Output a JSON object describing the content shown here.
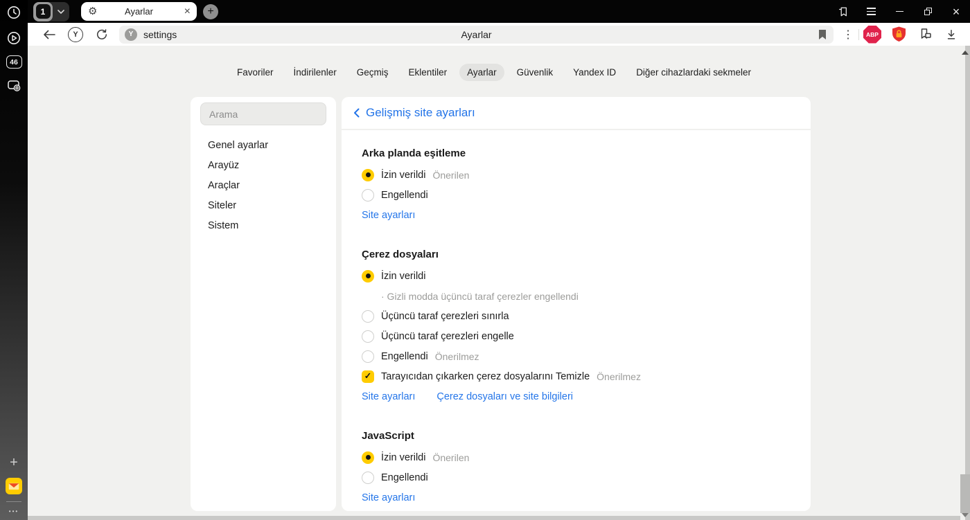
{
  "colors": {
    "accent_yellow": "#ffcc00",
    "link_blue": "#2576e9",
    "abp_red": "#e0234c",
    "protect_red": "#e23333",
    "page_bg": "#f1f1ef",
    "chrome_black": "#050505"
  },
  "icons": {
    "gear": "⚙",
    "plus": "+",
    "close": "×",
    "menu_dots": "⋮",
    "more_dots": "•••",
    "check": "✓",
    "yandex_letter": "Y"
  },
  "browser": {
    "tab_bar": {
      "tab_count": "1",
      "tab_title": "Ayarlar"
    },
    "toolbar": {
      "url_text": "settings",
      "page_title": "Ayarlar",
      "abp_label": "ABP"
    }
  },
  "left_rail": {
    "badge_count": "46"
  },
  "nav_tabs": {
    "items": [
      {
        "label": "Favoriler",
        "active": false
      },
      {
        "label": "İndirilenler",
        "active": false
      },
      {
        "label": "Geçmiş",
        "active": false
      },
      {
        "label": "Eklentiler",
        "active": false
      },
      {
        "label": "Ayarlar",
        "active": true
      },
      {
        "label": "Güvenlik",
        "active": false
      },
      {
        "label": "Yandex ID",
        "active": false
      },
      {
        "label": "Diğer cihazlardaki sekmeler",
        "active": false
      }
    ]
  },
  "settings_menu": {
    "search_placeholder": "Arama",
    "items": [
      "Genel ayarlar",
      "Arayüz",
      "Araçlar",
      "Siteler",
      "Sistem"
    ]
  },
  "content": {
    "header": "Gelişmiş site ayarları",
    "sections": [
      {
        "title": "Arka planda eşitleme",
        "options": [
          {
            "type": "radio",
            "checked": true,
            "label": "İzin verildi",
            "badge": "Önerilen"
          },
          {
            "type": "radio",
            "checked": false,
            "label": "Engellendi"
          }
        ],
        "links": [
          "Site ayarları"
        ]
      },
      {
        "title": "Çerez dosyaları",
        "options": [
          {
            "type": "radio",
            "checked": true,
            "label": "İzin verildi"
          },
          {
            "type": "note",
            "label": "· Gizli modda üçüncü taraf çerezler engellendi"
          },
          {
            "type": "radio",
            "checked": false,
            "label": "Üçüncü taraf çerezleri sınırla"
          },
          {
            "type": "radio",
            "checked": false,
            "label": "Üçüncü taraf çerezleri engelle"
          },
          {
            "type": "radio",
            "checked": false,
            "label": "Engellendi",
            "badge": "Önerilmez"
          },
          {
            "type": "checkbox",
            "checked": true,
            "label": "Tarayıcıdan çıkarken çerez dosyalarını Temizle",
            "badge": "Önerilmez"
          }
        ],
        "links": [
          "Site ayarları",
          "Çerez dosyaları ve site bilgileri"
        ]
      },
      {
        "title": "JavaScript",
        "options": [
          {
            "type": "radio",
            "checked": true,
            "label": "İzin verildi",
            "badge": "Önerilen"
          },
          {
            "type": "radio",
            "checked": false,
            "label": "Engellendi"
          }
        ],
        "links": [
          "Site ayarları"
        ]
      }
    ]
  }
}
